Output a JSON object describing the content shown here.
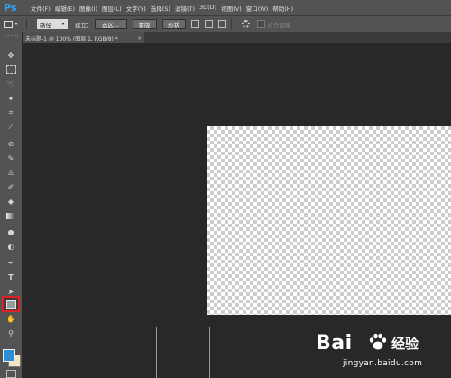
{
  "app": {
    "logo": "Ps"
  },
  "menu": [
    "文件(F)",
    "编辑(E)",
    "图像(I)",
    "图层(L)",
    "文字(Y)",
    "选择(S)",
    "滤镜(T)",
    "3D(D)",
    "视图(V)",
    "窗口(W)",
    "帮助(H)"
  ],
  "options": {
    "mode_select": "路径",
    "create_label": "建立：",
    "selection_button": "选区...",
    "mask_button": "蒙版",
    "shape_button": "形状",
    "align_edges_label": "对齐边缘"
  },
  "document": {
    "tab_title": "未标题-1 @ 100% (图层 1, RGB/8) *",
    "close": "×"
  },
  "tools": [
    "move-tool",
    "rectangular-marquee-tool",
    "lasso-tool",
    "quick-selection-tool",
    "crop-tool",
    "eyedropper-tool",
    "spot-healing-brush-tool",
    "brush-tool",
    "clone-stamp-tool",
    "history-brush-tool",
    "eraser-tool",
    "gradient-tool",
    "blur-tool",
    "dodge-tool",
    "pen-tool",
    "type-tool",
    "path-selection-tool",
    "rectangle-tool",
    "hand-tool",
    "zoom-tool"
  ],
  "active_tool": "rectangle-tool",
  "colors": {
    "foreground": "#2b8fd6",
    "background": "#f4e6c4",
    "highlight": "#e02020"
  },
  "watermark": {
    "brand": "Bai",
    "brand_cn": "经验",
    "url": "jingyan.baidu.com"
  }
}
